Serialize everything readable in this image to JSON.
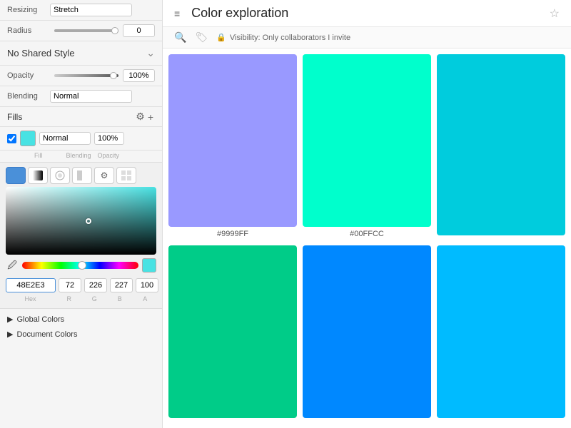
{
  "leftPanel": {
    "resizing": {
      "label": "Resizing",
      "value": "Stretch"
    },
    "radius": {
      "label": "Radius",
      "value": "0"
    },
    "noSharedStyle": {
      "text": "No Shared Style"
    },
    "opacity": {
      "label": "Opacity",
      "value": "100%"
    },
    "blending": {
      "label": "Blending",
      "value": "Normal"
    },
    "fills": {
      "header": "Fills",
      "settingsIcon": "⚙",
      "addIcon": "+",
      "blendingValue": "Normal",
      "opacityValue": "100%",
      "fillLabel": "Fill",
      "blendingLabel": "Blending",
      "opacityLabel": "Opacity"
    },
    "colorPicker": {
      "modes": [
        "solid",
        "linear",
        "radial",
        "angular",
        "image"
      ],
      "hexValue": "48E2E3",
      "rValue": "72",
      "gValue": "226",
      "bValue": "227",
      "aValue": "100",
      "hexLabel": "Hex",
      "rLabel": "R",
      "gLabel": "G",
      "bLabel": "B",
      "aLabel": "A"
    },
    "globalColors": "Global Colors",
    "documentColors": "Document Colors"
  },
  "rightPanel": {
    "title": "Color exploration",
    "visibility": "Visibility: Only collaborators I invite",
    "colors": [
      {
        "id": 1,
        "hex": "#9999FF",
        "label": "#9999FF",
        "swatch": "#9999FF"
      },
      {
        "id": 2,
        "hex": "#00FFCC",
        "label": "#00FFCC",
        "swatch": "#00FFCC"
      },
      {
        "id": 3,
        "hex": "#00DDEE",
        "label": "",
        "swatch": "#00DDEE"
      },
      {
        "id": 4,
        "hex": "#00CC88",
        "label": "",
        "swatch": "#00CC88"
      },
      {
        "id": 5,
        "hex": "#0099FF",
        "label": "",
        "swatch": "#0099FF"
      },
      {
        "id": 6,
        "hex": "#00CCFF",
        "label": "",
        "swatch": "#00CCFF"
      }
    ]
  }
}
